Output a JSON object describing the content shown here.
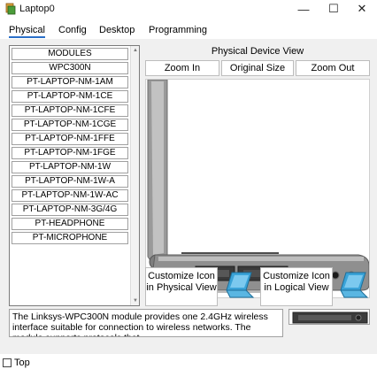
{
  "window": {
    "title": "Laptop0",
    "minimize_glyph": "—",
    "maximize_glyph": "☐",
    "close_glyph": "✕"
  },
  "tabs": [
    {
      "label": "Physical",
      "active": true
    },
    {
      "label": "Config",
      "active": false
    },
    {
      "label": "Desktop",
      "active": false
    },
    {
      "label": "Programming",
      "active": false
    }
  ],
  "module_list": {
    "items": [
      "MODULES",
      "WPC300N",
      "PT-LAPTOP-NM-1AM",
      "PT-LAPTOP-NM-1CE",
      "PT-LAPTOP-NM-1CFE",
      "PT-LAPTOP-NM-1CGE",
      "PT-LAPTOP-NM-1FFE",
      "PT-LAPTOP-NM-1FGE",
      "PT-LAPTOP-NM-1W",
      "PT-LAPTOP-NM-1W-A",
      "PT-LAPTOP-NM-1W-AC",
      "PT-LAPTOP-NM-3G/4G",
      "PT-HEADPHONE",
      "PT-MICROPHONE"
    ]
  },
  "device_view": {
    "title": "Physical Device View",
    "zoom_in_label": "Zoom In",
    "original_size_label": "Original Size",
    "zoom_out_label": "Zoom Out"
  },
  "customize": {
    "physical_label": "Customize Icon in Physical View",
    "logical_label": "Customize Icon in Logical View"
  },
  "description": "The Linksys-WPC300N module provides one 2.4GHz wireless interface suitable for connection to wireless networks. The module supports protocols that",
  "bottom": {
    "top_label": "Top",
    "top_checked": false
  },
  "colors": {
    "tab_underline": "#2a6fc9",
    "laptop_body": "#9a9a9a",
    "laptop_icon": "#3aa3d8"
  },
  "icons": {
    "app": "cisco-app-icon",
    "laptop": "laptop-icon"
  }
}
